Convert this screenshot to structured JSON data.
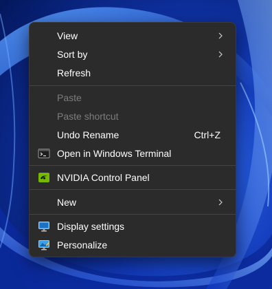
{
  "menu": {
    "view_label": "View",
    "sort_by_label": "Sort by",
    "refresh_label": "Refresh",
    "paste_label": "Paste",
    "paste_shortcut_label": "Paste shortcut",
    "undo_rename_label": "Undo Rename",
    "undo_rename_shortcut": "Ctrl+Z",
    "open_terminal_label": "Open in Windows Terminal",
    "nvidia_label": "NVIDIA Control Panel",
    "new_label": "New",
    "display_settings_label": "Display settings",
    "personalize_label": "Personalize"
  },
  "icons": {
    "submenu": "chevron-right-icon",
    "terminal": "terminal-icon",
    "nvidia": "nvidia-icon",
    "display": "monitor-icon",
    "personalize": "personalize-icon"
  },
  "colors": {
    "menu_background": "#2b2b2b",
    "text": "#ffffff",
    "disabled_text": "#7d7d7d",
    "separator": "#444444",
    "nvidia_green": "#76b900",
    "wallpaper_blue": "#0a2c8c"
  }
}
